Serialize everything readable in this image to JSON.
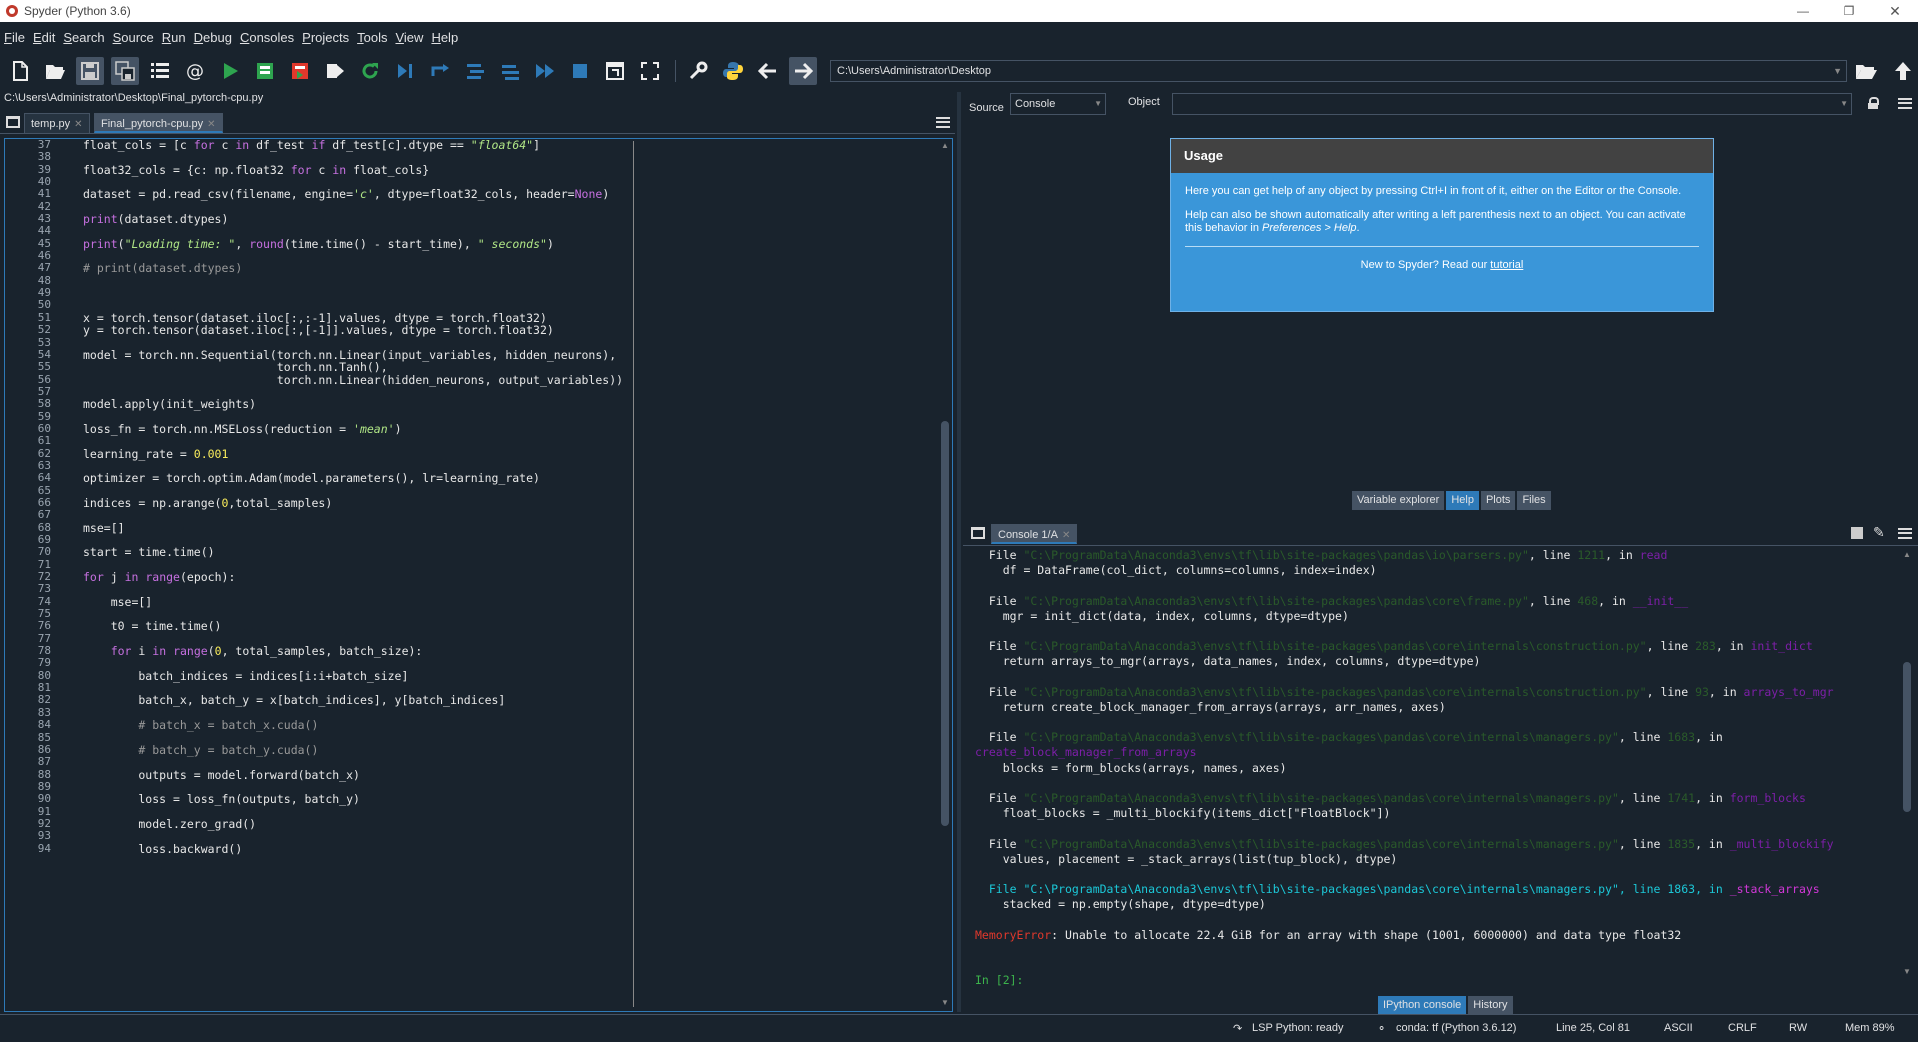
{
  "window": {
    "title": "Spyder (Python 3.6)"
  },
  "menu": [
    "File",
    "Edit",
    "Search",
    "Source",
    "Run",
    "Debug",
    "Consoles",
    "Projects",
    "Tools",
    "View",
    "Help"
  ],
  "toolbar": {
    "path": "C:\\Users\\Administrator\\Desktop",
    "icons": [
      "new-file-icon",
      "open-file-icon",
      "save-icon",
      "save-all-icon",
      "outline-icon",
      "at-icon",
      "run-icon",
      "run-cell-icon",
      "run-cell-advance-icon",
      "run-selection-icon",
      "rerun-icon",
      "debug-icon",
      "step-icon",
      "step-into-icon",
      "step-return-icon",
      "continue-icon",
      "stop-icon",
      "maximize-pane-icon",
      "fullscreen-icon",
      "preferences-icon",
      "python-path-icon",
      "back-icon",
      "forward-icon"
    ],
    "colors": {
      "run": "#2ea44f",
      "stop": "#2e7ab8",
      "accent": "#2e7ab8"
    }
  },
  "editor": {
    "file_path": "C:\\Users\\Administrator\\Desktop\\Final_pytorch-cpu.py",
    "tabs": [
      {
        "label": "temp.py",
        "active": false
      },
      {
        "label": "Final_pytorch-cpu.py",
        "active": true
      }
    ],
    "line_numbers": [
      "37",
      "38",
      "39",
      "40",
      "41",
      "42",
      "43",
      "44",
      "45",
      "46",
      "47",
      "48",
      "49",
      "50",
      "51",
      "52",
      "53",
      "54",
      "55",
      "56",
      "57",
      "58",
      "59",
      "60",
      "61",
      "62",
      "63",
      "64",
      "65",
      "66",
      "67",
      "68",
      "69",
      "70",
      "71",
      "72",
      "73",
      "74",
      "75",
      "76",
      "77",
      "78",
      "79",
      "80",
      "81",
      "82",
      "83",
      "84",
      "85",
      "86",
      "87",
      "88",
      "89",
      "90",
      "91",
      "92",
      "93",
      "94"
    ],
    "code_lines": [
      [
        [
          "t",
          "float_cols = [c "
        ],
        [
          "k",
          "for"
        ],
        [
          "t",
          " c "
        ],
        [
          "k",
          "in"
        ],
        [
          "t",
          " df_test "
        ],
        [
          "k",
          "if"
        ],
        [
          "t",
          " df_test[c].dtype == "
        ],
        [
          "s",
          "\"float64\""
        ],
        [
          "t",
          "]"
        ]
      ],
      [],
      [
        [
          "t",
          "float32_cols = {c: np.float32 "
        ],
        [
          "k",
          "for"
        ],
        [
          "t",
          " c "
        ],
        [
          "k",
          "in"
        ],
        [
          "t",
          " float_cols}"
        ]
      ],
      [],
      [
        [
          "t",
          "dataset = pd.read_csv(filename, engine="
        ],
        [
          "s",
          "'c'"
        ],
        [
          "t",
          ", dtype=float32_cols, header="
        ],
        [
          "k",
          "None"
        ],
        [
          "t",
          ")"
        ]
      ],
      [],
      [
        [
          "k",
          "print"
        ],
        [
          "t",
          "(dataset.dtypes)"
        ]
      ],
      [],
      [
        [
          "k",
          "print"
        ],
        [
          "t",
          "("
        ],
        [
          "s",
          "\"Loading time: \""
        ],
        [
          "t",
          ", "
        ],
        [
          "k",
          "round"
        ],
        [
          "t",
          "(time.time() - start_time), "
        ],
        [
          "s",
          "\" seconds\""
        ],
        [
          "t",
          ")"
        ]
      ],
      [],
      [
        [
          "c",
          "# print(dataset.dtypes)"
        ]
      ],
      [],
      [],
      [],
      [
        [
          "t",
          "x = torch.tensor(dataset.iloc[:,:-1].values, dtype = torch.float32)"
        ]
      ],
      [
        [
          "t",
          "y = torch.tensor(dataset.iloc[:,[-1]].values, dtype = torch.float32)"
        ]
      ],
      [],
      [
        [
          "t",
          "model = torch.nn.Sequential(torch.nn.Linear(input_variables, hidden_neurons),"
        ]
      ],
      [
        [
          "t",
          "                            torch.nn.Tanh(),"
        ]
      ],
      [
        [
          "t",
          "                            torch.nn.Linear(hidden_neurons, output_variables))"
        ]
      ],
      [],
      [
        [
          "t",
          "model.apply(init_weights)"
        ]
      ],
      [],
      [
        [
          "t",
          "loss_fn = torch.nn.MSELoss(reduction = "
        ],
        [
          "s",
          "'mean'"
        ],
        [
          "t",
          ")"
        ]
      ],
      [],
      [
        [
          "t",
          "learning_rate = "
        ],
        [
          "n",
          "0.001"
        ]
      ],
      [],
      [
        [
          "t",
          "optimizer = torch.optim.Adam(model.parameters(), lr=learning_rate)"
        ]
      ],
      [],
      [
        [
          "t",
          "indices = np.arange("
        ],
        [
          "n",
          "0"
        ],
        [
          "t",
          ",total_samples)"
        ]
      ],
      [],
      [
        [
          "t",
          "mse=[]"
        ]
      ],
      [],
      [
        [
          "t",
          "start = time.time()"
        ]
      ],
      [],
      [
        [
          "k",
          "for"
        ],
        [
          "t",
          " j "
        ],
        [
          "k",
          "in"
        ],
        [
          "t",
          " "
        ],
        [
          "k",
          "range"
        ],
        [
          "t",
          "(epoch):"
        ]
      ],
      [],
      [
        [
          "t",
          "    mse=[]"
        ]
      ],
      [],
      [
        [
          "t",
          "    t0 = time.time()"
        ]
      ],
      [],
      [
        [
          "t",
          "    "
        ],
        [
          "k",
          "for"
        ],
        [
          "t",
          " i "
        ],
        [
          "k",
          "in"
        ],
        [
          "t",
          " "
        ],
        [
          "k",
          "range"
        ],
        [
          "t",
          "("
        ],
        [
          "n",
          "0"
        ],
        [
          "t",
          ", total_samples, batch_size):"
        ]
      ],
      [],
      [
        [
          "t",
          "        batch_indices = indices[i:i+batch_size]"
        ]
      ],
      [],
      [
        [
          "t",
          "        batch_x, batch_y = x[batch_indices], y[batch_indices]"
        ]
      ],
      [],
      [
        [
          "t",
          "        "
        ],
        [
          "c",
          "# batch_x = batch_x.cuda()"
        ]
      ],
      [],
      [
        [
          "t",
          "        "
        ],
        [
          "c",
          "# batch_y = batch_y.cuda()"
        ]
      ],
      [],
      [
        [
          "t",
          "        outputs = model.forward(batch_x)"
        ]
      ],
      [],
      [
        [
          "t",
          "        loss = loss_fn(outputs, batch_y)"
        ]
      ],
      [],
      [
        [
          "t",
          "        model.zero_grad()"
        ]
      ],
      [],
      [
        [
          "t",
          "        loss.backward()"
        ]
      ]
    ]
  },
  "help": {
    "source_label": "Source",
    "source_value": "Console",
    "object_label": "Object",
    "object_value": "",
    "usage_title": "Usage",
    "usage_p1": "Here you can get help of any object by pressing Ctrl+I in front of it, either on the Editor or the Console.",
    "usage_p2_a": "Help can also be shown automatically after writing a left parenthesis next to an object. You can activate this behavior in ",
    "usage_p2_b": "Preferences > Help",
    "usage_p2_c": ".",
    "usage_foot_a": "New to Spyder? Read our ",
    "usage_foot_link": "tutorial",
    "tabs": [
      {
        "label": "Variable explorer",
        "active": false
      },
      {
        "label": "Help",
        "active": true
      },
      {
        "label": "Plots",
        "active": false
      },
      {
        "label": "Files",
        "active": false
      }
    ]
  },
  "console": {
    "tab_label": "Console 1/A",
    "lines": [
      [
        [
          "t",
          "  File "
        ],
        [
          "g",
          "\"C:\\ProgramData\\Anaconda3\\envs\\tf\\lib\\site-packages\\pandas\\io\\parsers.py\""
        ],
        [
          "t",
          ", line "
        ],
        [
          "g",
          "1211"
        ],
        [
          "t",
          ", in "
        ],
        [
          "p",
          "read"
        ]
      ],
      [
        [
          "t",
          "    df = DataFrame(col_dict, columns=columns, index=index)"
        ]
      ],
      [],
      [
        [
          "t",
          "  File "
        ],
        [
          "g",
          "\"C:\\ProgramData\\Anaconda3\\envs\\tf\\lib\\site-packages\\pandas\\core\\frame.py\""
        ],
        [
          "t",
          ", line "
        ],
        [
          "g",
          "468"
        ],
        [
          "t",
          ", in "
        ],
        [
          "p",
          "__init__"
        ]
      ],
      [
        [
          "t",
          "    mgr = init_dict(data, index, columns, dtype=dtype)"
        ]
      ],
      [],
      [
        [
          "t",
          "  File "
        ],
        [
          "g",
          "\"C:\\ProgramData\\Anaconda3\\envs\\tf\\lib\\site-packages\\pandas\\core\\internals\\construction.py\""
        ],
        [
          "t",
          ", line "
        ],
        [
          "g",
          "283"
        ],
        [
          "t",
          ", in "
        ],
        [
          "p",
          "init_dict"
        ]
      ],
      [
        [
          "t",
          "    return arrays_to_mgr(arrays, data_names, index, columns, dtype=dtype)"
        ]
      ],
      [],
      [
        [
          "t",
          "  File "
        ],
        [
          "g",
          "\"C:\\ProgramData\\Anaconda3\\envs\\tf\\lib\\site-packages\\pandas\\core\\internals\\construction.py\""
        ],
        [
          "t",
          ", line "
        ],
        [
          "g",
          "93"
        ],
        [
          "t",
          ", in "
        ],
        [
          "p",
          "arrays_to_mgr"
        ]
      ],
      [
        [
          "t",
          "    return create_block_manager_from_arrays(arrays, arr_names, axes)"
        ]
      ],
      [],
      [
        [
          "t",
          "  File "
        ],
        [
          "g",
          "\"C:\\ProgramData\\Anaconda3\\envs\\tf\\lib\\site-packages\\pandas\\core\\internals\\managers.py\""
        ],
        [
          "t",
          ", line "
        ],
        [
          "g",
          "1683"
        ],
        [
          "t",
          ", in"
        ]
      ],
      [
        [
          "p",
          "create_block_manager_from_arrays"
        ]
      ],
      [
        [
          "t",
          "    blocks = form_blocks(arrays, names, axes)"
        ]
      ],
      [],
      [
        [
          "t",
          "  File "
        ],
        [
          "g",
          "\"C:\\ProgramData\\Anaconda3\\envs\\tf\\lib\\site-packages\\pandas\\core\\internals\\managers.py\""
        ],
        [
          "t",
          ", line "
        ],
        [
          "g",
          "1741"
        ],
        [
          "t",
          ", in "
        ],
        [
          "p",
          "form_blocks"
        ]
      ],
      [
        [
          "t",
          "    float_blocks = _multi_blockify(items_dict[\"FloatBlock\"])"
        ]
      ],
      [],
      [
        [
          "t",
          "  File "
        ],
        [
          "g",
          "\"C:\\ProgramData\\Anaconda3\\envs\\tf\\lib\\site-packages\\pandas\\core\\internals\\managers.py\""
        ],
        [
          "t",
          ", line "
        ],
        [
          "g",
          "1835"
        ],
        [
          "t",
          ", in "
        ],
        [
          "p",
          "_multi_blockify"
        ]
      ],
      [
        [
          "t",
          "    values, placement = _stack_arrays(list(tup_block), dtype)"
        ]
      ],
      [],
      [
        [
          "c",
          "  File "
        ],
        [
          "G",
          "\"C:\\ProgramData\\Anaconda3\\envs\\tf\\lib\\site-packages\\pandas\\core\\internals\\managers.py\""
        ],
        [
          "c",
          ", line "
        ],
        [
          "G",
          "1863"
        ],
        [
          "c",
          ", in "
        ],
        [
          "m",
          "_stack_arrays"
        ]
      ],
      [
        [
          "t",
          "    stacked = np.empty(shape, dtype=dtype)"
        ]
      ],
      [],
      [
        [
          "r",
          "MemoryError"
        ],
        [
          "t",
          ": Unable to allocate 22.4 GiB for an array with shape (1001, 6000000) and data type float32"
        ]
      ],
      [],
      [],
      [
        [
          "P",
          "In [2]:"
        ]
      ]
    ],
    "tabs": [
      {
        "label": "IPython console",
        "active": true
      },
      {
        "label": "History",
        "active": false
      }
    ]
  },
  "status": {
    "lsp": "LSP Python: ready",
    "conda": "conda: tf (Python 3.6.12)",
    "position": "Line 25, Col 81",
    "encoding": "ASCII",
    "eol": "CRLF",
    "mode": "RW",
    "mem": "Mem 89%"
  }
}
